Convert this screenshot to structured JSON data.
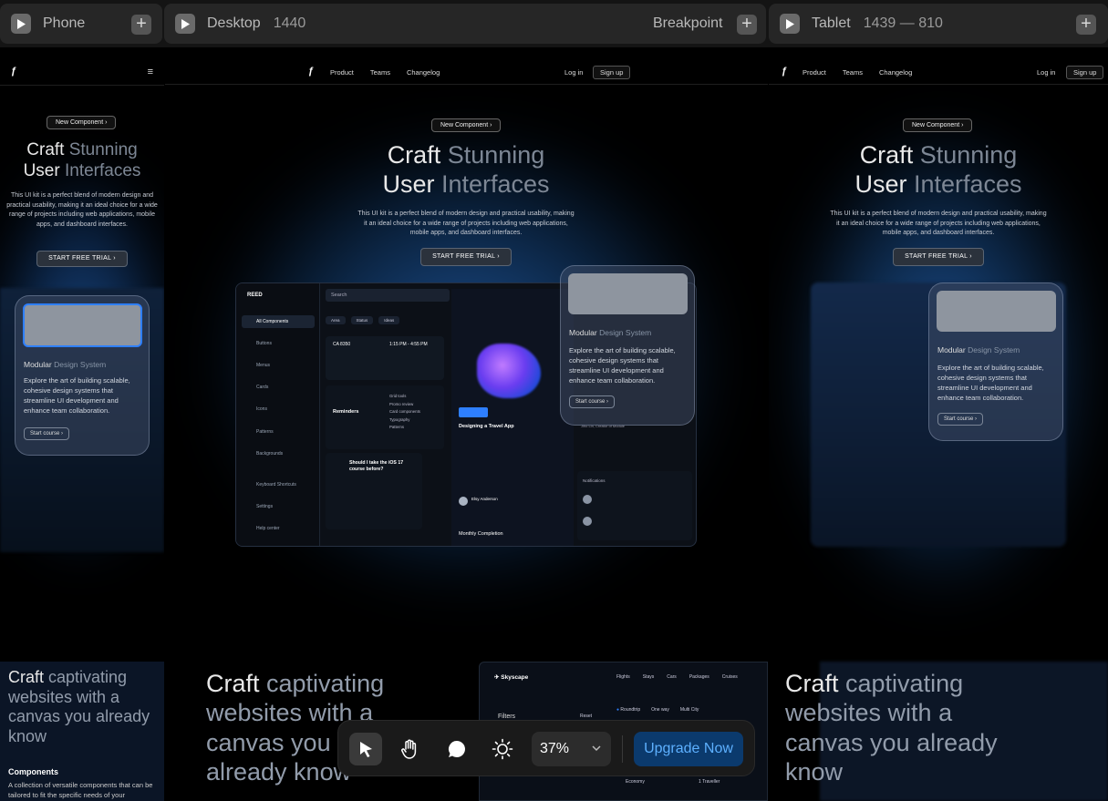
{
  "tabs": {
    "phone": {
      "label": "Phone"
    },
    "desktop": {
      "label": "Desktop",
      "width": "1440",
      "breakpoint_label": "Breakpoint"
    },
    "tablet": {
      "label": "Tablet",
      "size": "1439 — 810"
    }
  },
  "site": {
    "nav": {
      "product": "Product",
      "teams": "Teams",
      "changelog": "Changelog",
      "login": "Log in",
      "signup": "Sign up"
    },
    "pill": "New Component",
    "hero_line1_a": "Craft ",
    "hero_line1_b": "Stunning",
    "hero_line2_a": "User ",
    "hero_line2_b": "Interfaces",
    "description": "This UI kit is a perfect blend of modern design and practical usability, making it an ideal choice for a wide range of projects including web applications, mobile apps, and dashboard interfaces.",
    "cta": "START FREE TRIAL",
    "glass_card": {
      "title_a": "Modular ",
      "title_b": "Design System",
      "description": "Explore the art of building scalable, cohesive design systems that streamline UI development and enhance team collaboration.",
      "button": "Start course"
    },
    "bottom_heading_a": "Craft ",
    "bottom_heading_b": "captivating websites with a canvas you already know",
    "components_heading": "Components",
    "components_text": "A collection of versatile components that can be tailored to fit the specific needs of your"
  },
  "dashboard": {
    "brand": "REED",
    "search": "Search",
    "sidebar": [
      "All Components",
      "Buttons",
      "Menus",
      "Cards",
      "Icons",
      "Patterns",
      "Backgrounds",
      "Keyboard Shortcuts",
      "Settings",
      "Help center"
    ],
    "chips": [
      "Area",
      "Status",
      "Ideas"
    ],
    "flight": {
      "code": "CA 8350",
      "time": "1:15 PM - 4:55 PM"
    },
    "reminders": "Reminders",
    "checklist": [
      "Grid tools",
      "Promo review",
      "Card components",
      "Typography",
      "Patterns"
    ],
    "question": "Should I take the iOS 17 course before?",
    "card_title": "Designing a Travel App",
    "author": "Elsy Anderson",
    "monthly": "Monthly Completion",
    "notifications": "Notifications",
    "quote_author": "Jiho Lin, Creator of Module"
  },
  "skyscape": {
    "brand": "Skyscape",
    "nav": [
      "Flights",
      "Stays",
      "Cars",
      "Packages",
      "Cruises"
    ],
    "filters": "Filters",
    "reset": "Reset",
    "trip_types": [
      "Roundtrip",
      "One way",
      "Multi City"
    ],
    "economy": "Economy",
    "traveler": "1 Traveller"
  },
  "toolbar": {
    "zoom": "37%",
    "upgrade": "Upgrade Now"
  },
  "colors": {
    "accent": "#5db0ff",
    "upgrade_bg": "#0b3a6d",
    "glow": "#1b4f8f"
  }
}
